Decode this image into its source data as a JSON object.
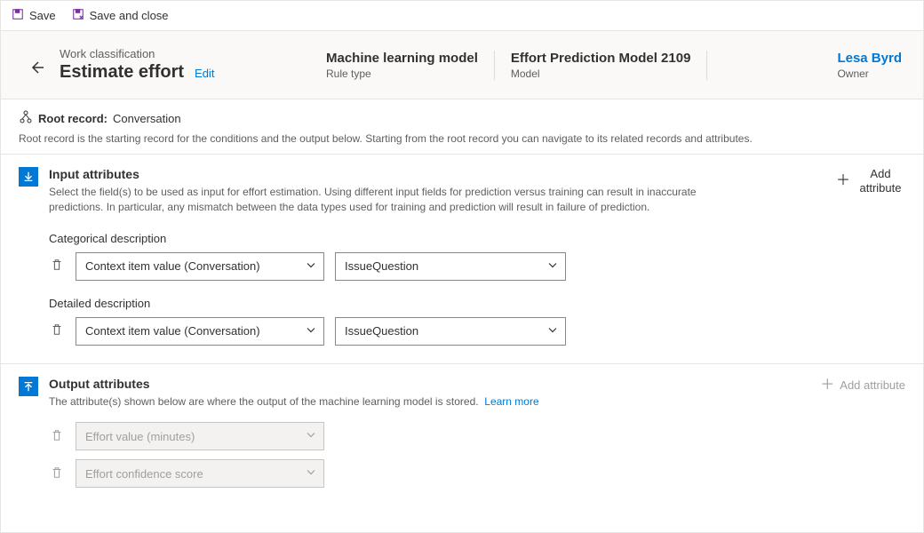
{
  "cmdbar": {
    "save": "Save",
    "save_close": "Save and close"
  },
  "header": {
    "breadcrumb": "Work classification",
    "title": "Estimate effort",
    "edit": "Edit",
    "rule_type_value": "Machine learning model",
    "rule_type_label": "Rule type",
    "model_value": "Effort Prediction Model 2109",
    "model_label": "Model",
    "owner_name": "Lesa Byrd",
    "owner_label": "Owner"
  },
  "root": {
    "label": "Root record:",
    "value": "Conversation",
    "desc": "Root record is the starting record for the conditions and the output below. Starting from the root record you can navigate to its related records and attributes."
  },
  "sections": {
    "input": {
      "title": "Input attributes",
      "desc": "Select the field(s) to be used as input for effort estimation. Using different input fields for prediction versus training can result in inaccurate predictions. In particular, any mismatch between the data types used for training and prediction will result in failure of prediction.",
      "add_label": "Add attribute",
      "groups": [
        {
          "label": "Categorical description",
          "field": "Context item value (Conversation)",
          "value": "IssueQuestion"
        },
        {
          "label": "Detailed description",
          "field": "Context item value (Conversation)",
          "value": "IssueQuestion"
        }
      ]
    },
    "output": {
      "title": "Output attributes",
      "desc_pre": "The attribute(s) shown below are where the output of the machine learning model is stored.",
      "learn_more": "Learn more",
      "add_label": "Add attribute",
      "rows": [
        {
          "field": "Effort value (minutes)"
        },
        {
          "field": "Effort confidence score"
        }
      ]
    }
  }
}
